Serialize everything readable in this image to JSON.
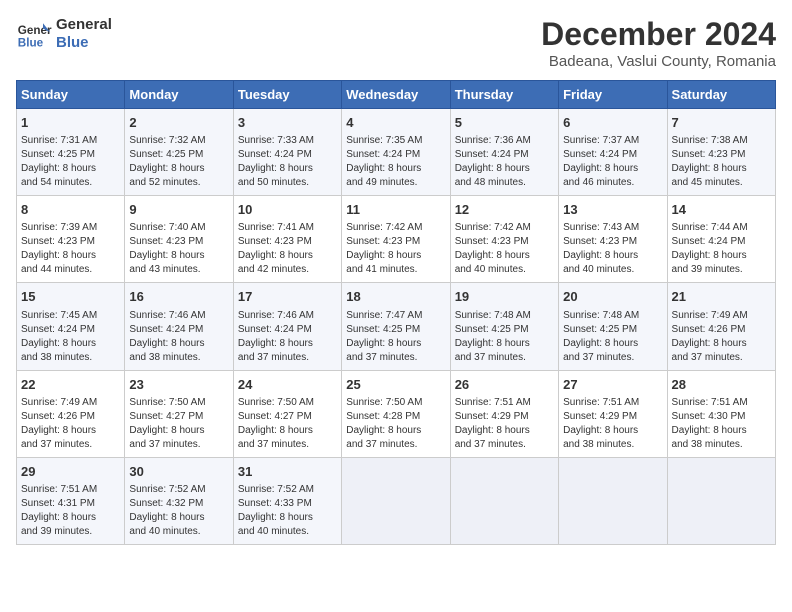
{
  "header": {
    "logo_line1": "General",
    "logo_line2": "Blue",
    "title": "December 2024",
    "subtitle": "Badeana, Vaslui County, Romania"
  },
  "weekdays": [
    "Sunday",
    "Monday",
    "Tuesday",
    "Wednesday",
    "Thursday",
    "Friday",
    "Saturday"
  ],
  "weeks": [
    [
      {
        "day": "1",
        "sunrise": "7:31 AM",
        "sunset": "4:25 PM",
        "daylight": "8 hours and 54 minutes."
      },
      {
        "day": "2",
        "sunrise": "7:32 AM",
        "sunset": "4:25 PM",
        "daylight": "8 hours and 52 minutes."
      },
      {
        "day": "3",
        "sunrise": "7:33 AM",
        "sunset": "4:24 PM",
        "daylight": "8 hours and 50 minutes."
      },
      {
        "day": "4",
        "sunrise": "7:35 AM",
        "sunset": "4:24 PM",
        "daylight": "8 hours and 49 minutes."
      },
      {
        "day": "5",
        "sunrise": "7:36 AM",
        "sunset": "4:24 PM",
        "daylight": "8 hours and 48 minutes."
      },
      {
        "day": "6",
        "sunrise": "7:37 AM",
        "sunset": "4:24 PM",
        "daylight": "8 hours and 46 minutes."
      },
      {
        "day": "7",
        "sunrise": "7:38 AM",
        "sunset": "4:23 PM",
        "daylight": "8 hours and 45 minutes."
      }
    ],
    [
      {
        "day": "8",
        "sunrise": "7:39 AM",
        "sunset": "4:23 PM",
        "daylight": "8 hours and 44 minutes."
      },
      {
        "day": "9",
        "sunrise": "7:40 AM",
        "sunset": "4:23 PM",
        "daylight": "8 hours and 43 minutes."
      },
      {
        "day": "10",
        "sunrise": "7:41 AM",
        "sunset": "4:23 PM",
        "daylight": "8 hours and 42 minutes."
      },
      {
        "day": "11",
        "sunrise": "7:42 AM",
        "sunset": "4:23 PM",
        "daylight": "8 hours and 41 minutes."
      },
      {
        "day": "12",
        "sunrise": "7:42 AM",
        "sunset": "4:23 PM",
        "daylight": "8 hours and 40 minutes."
      },
      {
        "day": "13",
        "sunrise": "7:43 AM",
        "sunset": "4:23 PM",
        "daylight": "8 hours and 40 minutes."
      },
      {
        "day": "14",
        "sunrise": "7:44 AM",
        "sunset": "4:24 PM",
        "daylight": "8 hours and 39 minutes."
      }
    ],
    [
      {
        "day": "15",
        "sunrise": "7:45 AM",
        "sunset": "4:24 PM",
        "daylight": "8 hours and 38 minutes."
      },
      {
        "day": "16",
        "sunrise": "7:46 AM",
        "sunset": "4:24 PM",
        "daylight": "8 hours and 38 minutes."
      },
      {
        "day": "17",
        "sunrise": "7:46 AM",
        "sunset": "4:24 PM",
        "daylight": "8 hours and 37 minutes."
      },
      {
        "day": "18",
        "sunrise": "7:47 AM",
        "sunset": "4:25 PM",
        "daylight": "8 hours and 37 minutes."
      },
      {
        "day": "19",
        "sunrise": "7:48 AM",
        "sunset": "4:25 PM",
        "daylight": "8 hours and 37 minutes."
      },
      {
        "day": "20",
        "sunrise": "7:48 AM",
        "sunset": "4:25 PM",
        "daylight": "8 hours and 37 minutes."
      },
      {
        "day": "21",
        "sunrise": "7:49 AM",
        "sunset": "4:26 PM",
        "daylight": "8 hours and 37 minutes."
      }
    ],
    [
      {
        "day": "22",
        "sunrise": "7:49 AM",
        "sunset": "4:26 PM",
        "daylight": "8 hours and 37 minutes."
      },
      {
        "day": "23",
        "sunrise": "7:50 AM",
        "sunset": "4:27 PM",
        "daylight": "8 hours and 37 minutes."
      },
      {
        "day": "24",
        "sunrise": "7:50 AM",
        "sunset": "4:27 PM",
        "daylight": "8 hours and 37 minutes."
      },
      {
        "day": "25",
        "sunrise": "7:50 AM",
        "sunset": "4:28 PM",
        "daylight": "8 hours and 37 minutes."
      },
      {
        "day": "26",
        "sunrise": "7:51 AM",
        "sunset": "4:29 PM",
        "daylight": "8 hours and 37 minutes."
      },
      {
        "day": "27",
        "sunrise": "7:51 AM",
        "sunset": "4:29 PM",
        "daylight": "8 hours and 38 minutes."
      },
      {
        "day": "28",
        "sunrise": "7:51 AM",
        "sunset": "4:30 PM",
        "daylight": "8 hours and 38 minutes."
      }
    ],
    [
      {
        "day": "29",
        "sunrise": "7:51 AM",
        "sunset": "4:31 PM",
        "daylight": "8 hours and 39 minutes."
      },
      {
        "day": "30",
        "sunrise": "7:52 AM",
        "sunset": "4:32 PM",
        "daylight": "8 hours and 40 minutes."
      },
      {
        "day": "31",
        "sunrise": "7:52 AM",
        "sunset": "4:33 PM",
        "daylight": "8 hours and 40 minutes."
      },
      null,
      null,
      null,
      null
    ]
  ]
}
